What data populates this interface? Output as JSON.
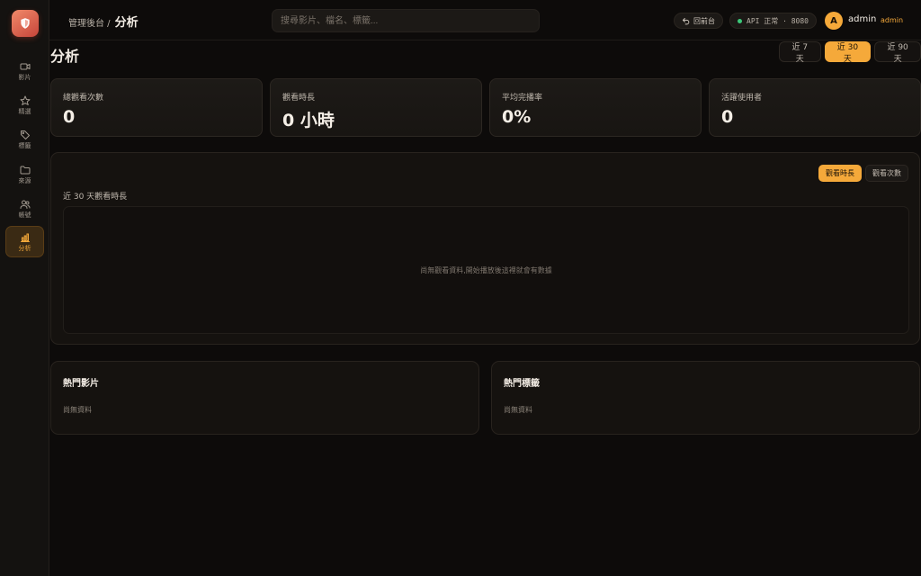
{
  "sidebar": {
    "items": [
      {
        "label": "影片",
        "icon": "video-icon"
      },
      {
        "label": "精選",
        "icon": "star-icon"
      },
      {
        "label": "標籤",
        "icon": "tag-icon"
      },
      {
        "label": "來源",
        "icon": "folder-icon"
      },
      {
        "label": "帳號",
        "icon": "users-icon"
      },
      {
        "label": "分析",
        "icon": "bar-chart-icon",
        "active": true
      }
    ]
  },
  "header": {
    "breadcrumb_root": "管理後台 /",
    "breadcrumb_current": "分析",
    "search_placeholder": "搜尋影片、檔名、標籤...",
    "back_label": "回前台",
    "api_status": "API 正常 · 8080",
    "avatar_initial": "A",
    "username": "admin",
    "role": "admin"
  },
  "page": {
    "title": "分析",
    "ranges": [
      "近 7 天",
      "近 30 天",
      "近 90 天"
    ],
    "active_range": 1
  },
  "stats": [
    {
      "label": "總觀看次數",
      "value": "0"
    },
    {
      "label": "觀看時長",
      "value": "0 小時"
    },
    {
      "label": "平均完播率",
      "value": "0%"
    },
    {
      "label": "活躍使用者",
      "value": "0"
    }
  ],
  "chart": {
    "title": "近 30 天觀看時長",
    "tabs": [
      "觀看時長",
      "觀看次數"
    ],
    "active_tab": 0,
    "empty_text": "尚無觀看資料,開始播放後這裡就會有數據"
  },
  "lists": [
    {
      "title": "熱門影片",
      "empty_text": "尚無資料"
    },
    {
      "title": "熱門標籤",
      "empty_text": "尚無資料"
    }
  ],
  "colors": {
    "accent": "#f5a93a",
    "background": "#0d0b0a",
    "card": "#1d1a17",
    "status_ok": "#3cc97a"
  }
}
